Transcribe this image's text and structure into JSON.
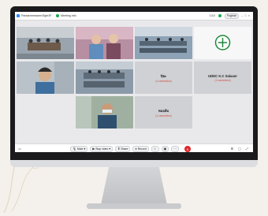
{
  "titlebar": {
    "tab1_label": "Pantaneeeaseer2tgte3F",
    "tab2_label": "Meeting info",
    "timer": "13:0",
    "pill_label": "Paginati"
  },
  "tiles": {
    "name_tile_1": {
      "name": "ปิยะ",
      "status": "(1 connection)"
    },
    "name_tile_2": {
      "name": "UDDC K.C Salaanr",
      "status": "(1 connection)"
    },
    "name_tile_3": {
      "name": "หมอส้ม",
      "status": "(1 connection)"
    }
  },
  "toolbar": {
    "mute_label": "Mute",
    "stop_video_label": "Stop video",
    "share_label": "Share",
    "record_label": "Record"
  },
  "colors": {
    "accent": "#2d8cff",
    "end": "#e0262a",
    "status_red": "#c84a3a"
  }
}
